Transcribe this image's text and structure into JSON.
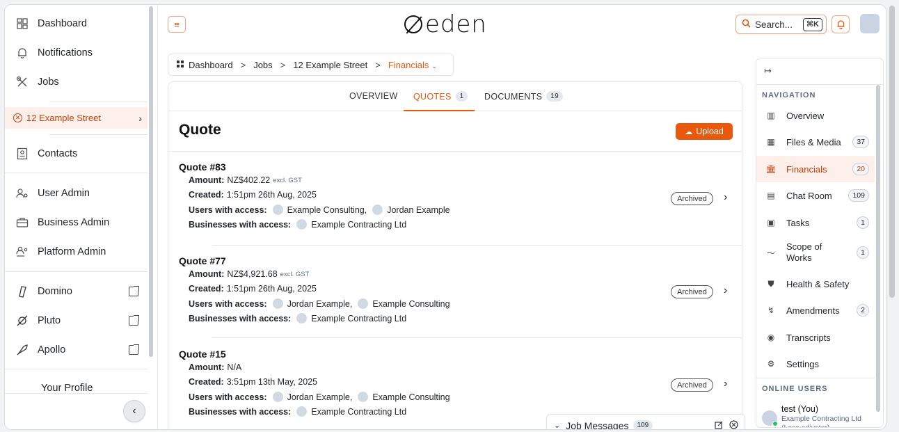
{
  "app": {
    "logo": "eden"
  },
  "colors": {
    "accent": "#ea580c",
    "accent_bg": "#fdf0ea"
  },
  "sidebar": {
    "items": [
      {
        "label": "Dashboard",
        "icon": "grid-icon"
      },
      {
        "label": "Notifications",
        "icon": "bell-icon"
      },
      {
        "label": "Jobs",
        "icon": "tools-icon"
      },
      {
        "label": "12 Example Street",
        "icon": "close-circle-icon"
      },
      {
        "label": "Contacts",
        "icon": "contact-card-icon"
      },
      {
        "label": "User Admin",
        "icon": "users-cog-icon"
      },
      {
        "label": "Business Admin",
        "icon": "briefcase-icon"
      },
      {
        "label": "Platform Admin",
        "icon": "platform-users-icon"
      },
      {
        "label": "Domino",
        "icon": "domino-logo-icon"
      },
      {
        "label": "Pluto",
        "icon": "pluto-logo-icon"
      },
      {
        "label": "Apollo",
        "icon": "rocket-icon"
      },
      {
        "label": "Your Profile",
        "icon": "user-icon"
      }
    ],
    "collapse_label": "‹"
  },
  "header": {
    "search_placeholder": "Search...",
    "search_shortcut": "⌘K"
  },
  "breadcrumb": {
    "items": [
      "Dashboard",
      "Jobs",
      "12 Example Street",
      "Financials"
    ],
    "separator": ">"
  },
  "tabs": [
    {
      "label": "OVERVIEW",
      "count": ""
    },
    {
      "label": "QUOTES",
      "count": "1"
    },
    {
      "label": "DOCUMENTS",
      "count": "19"
    }
  ],
  "main": {
    "title": "Quote",
    "upload_label": "Upload",
    "labels": {
      "amount": "Amount:",
      "created": "Created:",
      "users": "Users with access:",
      "businesses": "Businesses with access:",
      "gst": "excl. GST"
    },
    "quotes": [
      {
        "title": "Quote #83",
        "amount": "NZ$402.22",
        "created": "1:51pm 26th Aug, 2025",
        "user1": "Example Consulting,",
        "user2": "Jordan Example",
        "business": "Example Contracting Ltd",
        "status": "Archived"
      },
      {
        "title": "Quote #77",
        "amount": "NZ$4,921.68",
        "created": "1:51pm 26th Aug, 2025",
        "user1": "Jordan Example,",
        "user2": "Example Consulting",
        "business": "Example Contracting Ltd",
        "status": "Archived"
      },
      {
        "title": "Quote #15",
        "amount": "N/A",
        "created": "3:51pm 13th May, 2025",
        "user1": "Jordan Example,",
        "user2": "Example Consulting",
        "business": "Example Contracting Ltd",
        "status": "Archived"
      }
    ]
  },
  "job_messages": {
    "label": "Job Messages",
    "count": "109"
  },
  "right_panel": {
    "nav_heading": "NAVIGATION",
    "items": [
      {
        "label": "Overview",
        "count": ""
      },
      {
        "label": "Files & Media",
        "count": "37"
      },
      {
        "label": "Financials",
        "count": "20"
      },
      {
        "label": "Chat Room",
        "count": "109"
      },
      {
        "label": "Tasks",
        "count": "1"
      },
      {
        "label": "Scope of Works",
        "count": "1"
      },
      {
        "label": "Health & Safety",
        "count": ""
      },
      {
        "label": "Amendments",
        "count": "2"
      },
      {
        "label": "Transcripts",
        "count": ""
      },
      {
        "label": "Settings",
        "count": ""
      }
    ],
    "online_heading": "ONLINE USERS",
    "online_user": {
      "name": "test (You)",
      "company": "Example Contracting Ltd",
      "role": "(Loss adjuster)"
    }
  }
}
